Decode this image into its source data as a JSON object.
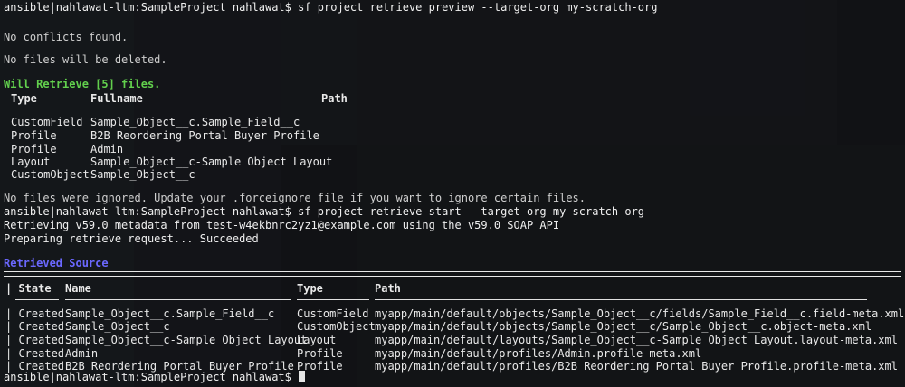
{
  "prompt": "ansible|nahlawat-ltm:SampleProject nahlawat$",
  "cmd1": "sf project retrieve preview --target-org my-scratch-org",
  "no_conflicts": "No conflicts found.",
  "no_deleted": "No files will be deleted.",
  "will_retrieve": "Will Retrieve [5] files.",
  "preview_headers": {
    "type": "Type",
    "fullname": "Fullname",
    "path": "Path"
  },
  "preview_rows": [
    {
      "type": "CustomField",
      "fullname": "Sample_Object__c.Sample_Field__c"
    },
    {
      "type": "Profile",
      "fullname": "B2B Reordering Portal Buyer Profile"
    },
    {
      "type": "Profile",
      "fullname": "Admin"
    },
    {
      "type": "Layout",
      "fullname": "Sample_Object__c-Sample Object Layout"
    },
    {
      "type": "CustomObject",
      "fullname": "Sample_Object__c"
    }
  ],
  "no_ignored": "No files were ignored. Update your .forceignore file if you want to ignore certain files.",
  "cmd2": "sf project retrieve start --target-org my-scratch-org",
  "retrieving": "Retrieving v59.0 metadata from test-w4ekbnrc2yz1@example.com using the v59.0 SOAP API",
  "preparing": "Preparing retrieve request... Succeeded",
  "retrieved_source": "Retrieved Source",
  "source_headers": {
    "state": "State",
    "name": "Name",
    "type": "Type",
    "path": "Path"
  },
  "source_rows": [
    {
      "state": "Created",
      "name": "Sample_Object__c.Sample_Field__c",
      "type": "CustomField",
      "path": "myapp/main/default/objects/Sample_Object__c/fields/Sample_Field__c.field-meta.xml"
    },
    {
      "state": "Created",
      "name": "Sample_Object__c",
      "type": "CustomObject",
      "path": "myapp/main/default/objects/Sample_Object__c/Sample_Object__c.object-meta.xml"
    },
    {
      "state": "Created",
      "name": "Sample_Object__c-Sample Object Layout",
      "type": "Layout",
      "path": "myapp/main/default/layouts/Sample_Object__c-Sample Object Layout.layout-meta.xml"
    },
    {
      "state": "Created",
      "name": "Admin",
      "type": "Profile",
      "path": "myapp/main/default/profiles/Admin.profile-meta.xml"
    },
    {
      "state": "Created",
      "name": "B2B Reordering Portal Buyer Profile",
      "type": "Profile",
      "path": "myapp/main/default/profiles/B2B Reordering Portal Buyer Profile.profile-meta.xml"
    }
  ],
  "colors": {
    "green": "#62d04d",
    "blue": "#6b68ff",
    "text": "#efefef",
    "background": "#101114"
  }
}
